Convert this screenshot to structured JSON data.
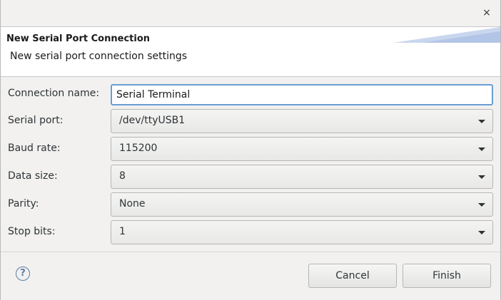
{
  "window": {
    "close_glyph": "×"
  },
  "header": {
    "title": "New Serial Port Connection",
    "description": "New serial port connection settings"
  },
  "form": {
    "connection_name": {
      "label": "Connection name:",
      "value": "Serial Terminal"
    },
    "serial_port": {
      "label": "Serial port:",
      "value": "/dev/ttyUSB1"
    },
    "baud_rate": {
      "label": "Baud rate:",
      "value": "115200"
    },
    "data_size": {
      "label": "Data size:",
      "value": "8"
    },
    "parity": {
      "label": "Parity:",
      "value": "None"
    },
    "stop_bits": {
      "label": "Stop bits:",
      "value": "1"
    }
  },
  "footer": {
    "help_glyph": "?",
    "cancel_label": "Cancel",
    "finish_label": "Finish"
  },
  "colors": {
    "focus_border": "#6a9ed4",
    "help_icon": "#5a7fa6",
    "banner": "#c9d6ee"
  }
}
